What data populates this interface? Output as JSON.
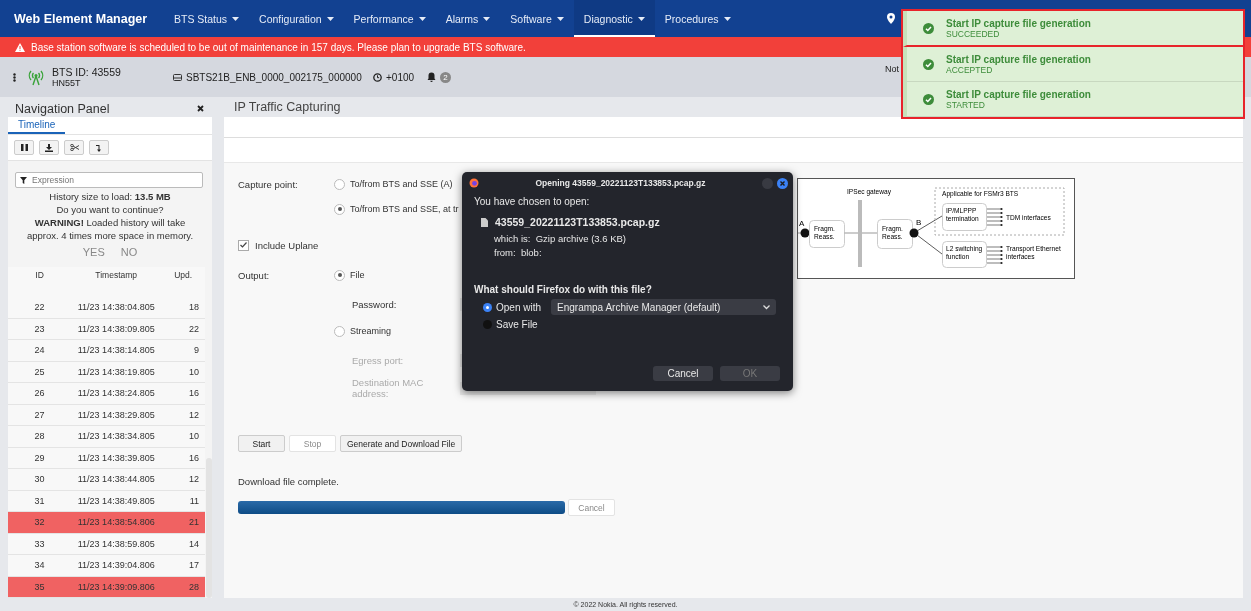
{
  "app": {
    "title": "Web Element Manager",
    "menu": [
      {
        "label": "BTS Status",
        "selected": false
      },
      {
        "label": "Configuration",
        "selected": false
      },
      {
        "label": "Performance",
        "selected": false
      },
      {
        "label": "Alarms",
        "selected": false
      },
      {
        "label": "Software",
        "selected": false
      },
      {
        "label": "Diagnostic",
        "selected": true
      },
      {
        "label": "Procedures",
        "selected": false
      }
    ]
  },
  "banner": {
    "text": "Base station software is scheduled to be out of maintenance in 157 days. Please plan to upgrade BTS software."
  },
  "bts_bar": {
    "bts_id": "BTS ID: 43559",
    "site": "HN55T",
    "software": "SBTS21B_ENB_0000_002175_000000",
    "timezone": "+0100",
    "alarm_count": "2",
    "status_text": "Not"
  },
  "navigation_panel": {
    "title": "Navigation Panel",
    "tabs": [
      {
        "label": "Timeline",
        "selected": true
      }
    ],
    "filter": {
      "placeholder": "Expression"
    },
    "history_notice": [
      "History size to load: **13.5 MB**",
      "Do you want to continue?",
      "**WARNING!** Loaded history will take approx. 4 times more space in memory."
    ],
    "actions": [
      "YES",
      "NO"
    ],
    "table": {
      "columns": [
        "ID",
        "Timestamp",
        "Upd."
      ],
      "rows": [
        {
          "cells": [
            "22",
            "11/23 14:38:04.805",
            "18"
          ],
          "highlighted": false
        },
        {
          "cells": [
            "23",
            "11/23 14:38:09.805",
            "22"
          ],
          "highlighted": false
        },
        {
          "cells": [
            "24",
            "11/23 14:38:14.805",
            "9"
          ],
          "highlighted": false
        },
        {
          "cells": [
            "25",
            "11/23 14:38:19.805",
            "10"
          ],
          "highlighted": false
        },
        {
          "cells": [
            "26",
            "11/23 14:38:24.805",
            "16"
          ],
          "highlighted": false
        },
        {
          "cells": [
            "27",
            "11/23 14:38:29.805",
            "12"
          ],
          "highlighted": false
        },
        {
          "cells": [
            "28",
            "11/23 14:38:34.805",
            "10"
          ],
          "highlighted": false
        },
        {
          "cells": [
            "29",
            "11/23 14:38:39.805",
            "16"
          ],
          "highlighted": false
        },
        {
          "cells": [
            "30",
            "11/23 14:38:44.805",
            "12"
          ],
          "highlighted": false
        },
        {
          "cells": [
            "31",
            "11/23 14:38:49.805",
            "11"
          ],
          "highlighted": false
        },
        {
          "cells": [
            "32",
            "11/23 14:38:54.806",
            "21"
          ],
          "highlighted": true
        },
        {
          "cells": [
            "33",
            "11/23 14:38:59.805",
            "14"
          ],
          "highlighted": false
        },
        {
          "cells": [
            "34",
            "11/23 14:39:04.806",
            "17"
          ],
          "highlighted": false
        },
        {
          "cells": [
            "35",
            "11/23 14:39:09.806",
            "28"
          ],
          "highlighted": true
        }
      ]
    }
  },
  "capture": {
    "title": "IP Traffic Capturing",
    "capture_point_label": "Capture point:",
    "capture_points": [
      {
        "label": "To/from BTS and SSE (A)",
        "selected": false
      },
      {
        "label": "To/from BTS and SSE, at tr",
        "selected": true
      }
    ],
    "include_uplane": {
      "label": "Include Uplane",
      "checked": true
    },
    "output_label": "Output:",
    "outputs": [
      {
        "label": "File",
        "selected": true,
        "fields": [
          {
            "label": "Password:",
            "disabled": false
          }
        ]
      },
      {
        "label": "Streaming",
        "selected": false,
        "fields": [
          {
            "label": "Egress port:",
            "disabled": true
          },
          {
            "label": "Destination MAC address:",
            "disabled": true
          }
        ]
      }
    ],
    "buttons": [
      {
        "label": "Start",
        "disabled": false
      },
      {
        "label": "Stop",
        "disabled": true
      },
      {
        "label": "Generate and Download File",
        "disabled": false
      }
    ],
    "status": "Download file complete.",
    "progress": {
      "level": 1
    },
    "cancel": {
      "label": "Cancel",
      "disabled": true
    },
    "diagram": {
      "gateway": "IPSec gateway",
      "scope": "Applicable for FSMr3 BTS",
      "point_a": "A",
      "point_b": "B",
      "fragm_1": [
        "Fragm.",
        "Reass."
      ],
      "fragm_2": [
        "Fragm.",
        "Reass."
      ],
      "ip_termination": [
        "IP/MLPPP",
        "termination"
      ],
      "l2_switching": [
        "L2 switching",
        "function"
      ],
      "tdm": "TDM interfaces",
      "ethernet": [
        "Transport Ethernet",
        "interfaces"
      ]
    }
  },
  "dialog": {
    "title": "Opening 43559_20221123T133853.pcap.gz",
    "intro": "You have chosen to open:",
    "file_name": "43559_20221123T133853.pcap.gz",
    "file_type": "which is:  Gzip archive (3.6 KB)",
    "source": "from:  blob:",
    "question": "What should Firefox do with this file?",
    "options": [
      {
        "label": "Open with",
        "selected": true,
        "app": "Engrampa Archive Manager (default)"
      },
      {
        "label": "Save File",
        "selected": false
      }
    ],
    "buttons": [
      {
        "label": "Cancel",
        "disabled": false
      },
      {
        "label": "OK",
        "disabled": true
      }
    ]
  },
  "notifications": [
    {
      "title": "Start IP capture file generation",
      "status": "SUCCEEDED"
    },
    {
      "title": "Start IP capture file generation",
      "status": "ACCEPTED"
    },
    {
      "title": "Start IP capture file generation",
      "status": "STARTED"
    }
  ],
  "footer": "© 2022 Nokia. All rights reserved."
}
